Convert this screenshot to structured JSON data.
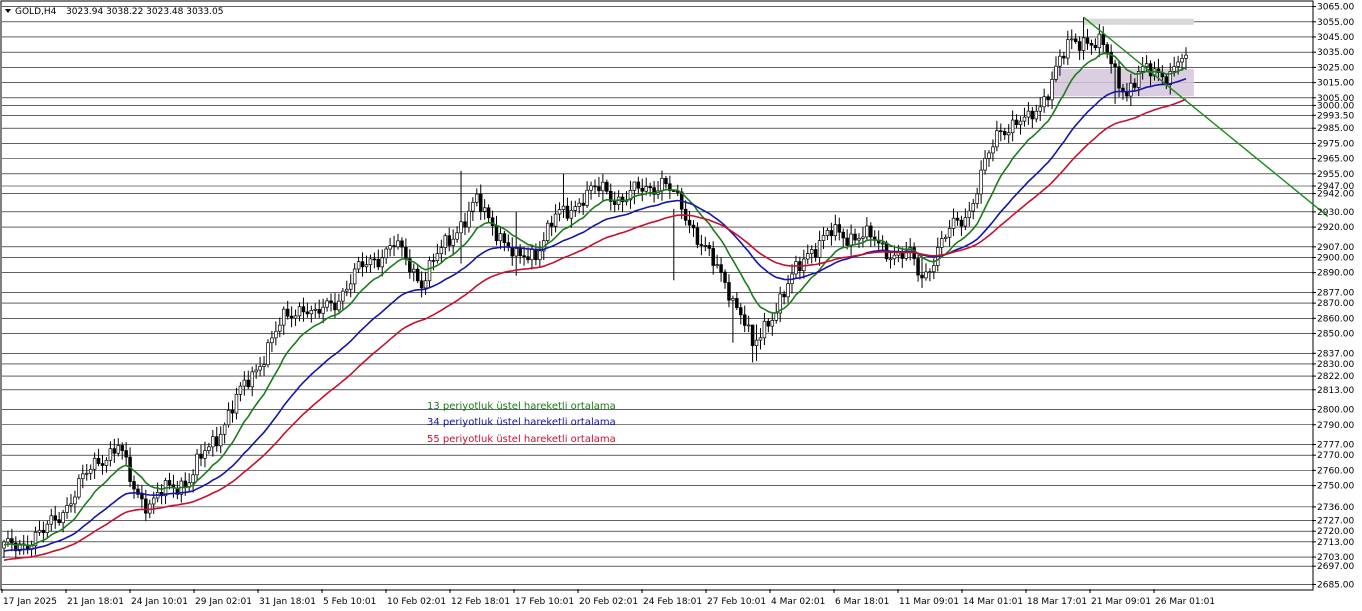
{
  "header": {
    "symbol": "GOLD,H4",
    "ohlc": "3023.94 3038.22 3023.48 3033.05"
  },
  "legend": [
    {
      "label": "13 periyotluk üstel hareketli ortalama",
      "color": "#1a7d1a"
    },
    {
      "label": "34 periyotluk üstel hareketli ortalama",
      "color": "#1515a8"
    },
    {
      "label": "55 periyotluk üstel hareketli ortalama",
      "color": "#c8102e"
    }
  ],
  "chart_data": {
    "type": "candlestick",
    "y_range": [
      2682.0,
      3068.0
    ],
    "price_levels": [
      3065.0,
      3055.0,
      3045.0,
      3035.0,
      3025.0,
      3015.0,
      3005.0,
      3000.0,
      2993.5,
      2985.0,
      2975.0,
      2965.0,
      2955.0,
      2947.0,
      2942.0,
      2930.0,
      2920.0,
      2907.0,
      2900.0,
      2890.0,
      2877.0,
      2870.0,
      2860.0,
      2850.0,
      2837.0,
      2830.0,
      2822.0,
      2813.0,
      2800.0,
      2790.0,
      2777.0,
      2770.0,
      2760.0,
      2750.0,
      2736.0,
      2727.0,
      2720.0,
      2713.0,
      2703.0,
      2697.0,
      2685.0
    ],
    "time_labels": [
      "17 Jan 2025",
      "21 Jan 18:01",
      "24 Jan 10:01",
      "29 Jan 02:01",
      "31 Jan 18:01",
      "5 Feb 10:01",
      "10 Feb 02:01",
      "12 Feb 18:01",
      "17 Feb 10:01",
      "20 Feb 02:01",
      "24 Feb 18:01",
      "27 Feb 10:01",
      "4 Mar 02:01",
      "6 Mar 18:01",
      "11 Mar 09:01",
      "14 Mar 01:01",
      "18 Mar 17:01",
      "21 Mar 09:01",
      "26 Mar 01:01"
    ],
    "price_path": [
      [
        0,
        2708
      ],
      [
        10,
        2718
      ],
      [
        18,
        2745
      ],
      [
        24,
        2768
      ],
      [
        29,
        2775
      ],
      [
        33,
        2748
      ],
      [
        37,
        2738
      ],
      [
        42,
        2748
      ],
      [
        47,
        2755
      ],
      [
        53,
        2778
      ],
      [
        57,
        2798
      ],
      [
        62,
        2818
      ],
      [
        67,
        2842
      ],
      [
        71,
        2858
      ],
      [
        76,
        2870
      ],
      [
        79,
        2860
      ],
      [
        84,
        2872
      ],
      [
        89,
        2888
      ],
      [
        94,
        2900
      ],
      [
        99,
        2908
      ],
      [
        103,
        2895
      ],
      [
        106,
        2885
      ],
      [
        110,
        2900
      ],
      [
        115,
        2920
      ],
      [
        120,
        2935
      ],
      [
        125,
        2920
      ],
      [
        130,
        2897
      ],
      [
        135,
        2905
      ],
      [
        140,
        2925
      ],
      [
        147,
        2940
      ],
      [
        152,
        2945
      ],
      [
        157,
        2938
      ],
      [
        162,
        2945
      ],
      [
        167,
        2950
      ],
      [
        170,
        2940
      ],
      [
        175,
        2920
      ],
      [
        180,
        2895
      ],
      [
        184,
        2880
      ],
      [
        188,
        2858
      ],
      [
        190,
        2838
      ],
      [
        194,
        2860
      ],
      [
        199,
        2880
      ],
      [
        204,
        2905
      ],
      [
        210,
        2915
      ],
      [
        217,
        2915
      ],
      [
        221,
        2910
      ],
      [
        226,
        2903
      ],
      [
        230,
        2900
      ],
      [
        233,
        2887
      ],
      [
        237,
        2905
      ],
      [
        241,
        2920
      ],
      [
        245,
        2932
      ],
      [
        249,
        2960
      ],
      [
        253,
        2985
      ],
      [
        257,
        2990
      ],
      [
        260,
        2988
      ],
      [
        263,
        3000
      ],
      [
        267,
        3025
      ],
      [
        271,
        3040
      ],
      [
        275,
        3045
      ],
      [
        279,
        3038
      ],
      [
        282,
        3020
      ],
      [
        285,
        3010
      ],
      [
        288,
        3020
      ],
      [
        292,
        3022
      ],
      [
        296,
        3022
      ],
      [
        300,
        3033
      ]
    ],
    "special_candles": [
      {
        "i": 116,
        "h": 2957,
        "l": 2896
      },
      {
        "i": 130,
        "h": 2930,
        "l": 2888
      },
      {
        "i": 142,
        "h": 2955,
        "l": 2926
      },
      {
        "i": 160,
        "h": 2948,
        "l": 2935
      },
      {
        "i": 170,
        "h": 2932,
        "l": 2885
      },
      {
        "i": 185,
        "h": 2875,
        "l": 2844
      },
      {
        "i": 190,
        "h": 2850,
        "l": 2831
      },
      {
        "i": 191,
        "h": 2856,
        "l": 2832
      },
      {
        "i": 233,
        "h": 2902,
        "l": 2880
      },
      {
        "i": 274,
        "h": 3058,
        "l": 3030
      },
      {
        "i": 282,
        "h": 3030,
        "l": 3001
      },
      {
        "i": 300,
        "h": 3038.22,
        "l": 3023.48
      }
    ],
    "range_box": {
      "x_start_index": 266,
      "x_end_index": 302,
      "y_high": 3024,
      "y_low": 3006,
      "color": "#d6c6dc"
    },
    "resistance_box": {
      "x_start_index": 274,
      "x_end_index": 302,
      "y_high": 3057,
      "y_low": 3053,
      "color": "#d8d8d8"
    },
    "trendline": {
      "start_index": 274,
      "start_price": 3058,
      "end_index": 336,
      "end_price": 2927,
      "color": "#1a8c1a"
    },
    "ema_periods": [
      13,
      34,
      55
    ],
    "ema_colors": [
      "#1a7d1a",
      "#1515a8",
      "#c8102e"
    ],
    "grid": "horizontal lines at price levels",
    "legend_placement": "center-left"
  }
}
